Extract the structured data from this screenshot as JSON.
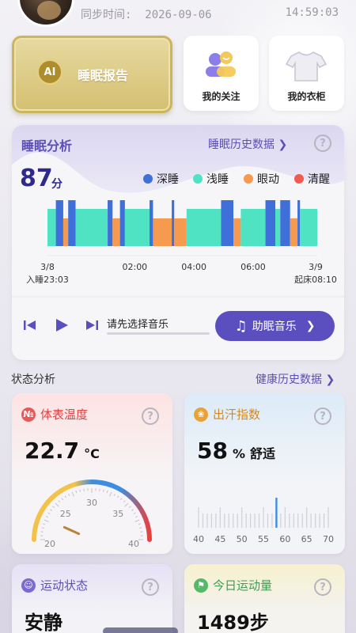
{
  "header": {
    "sync_label": "同步时间:",
    "sync_date": "2026-09-06",
    "sync_time": "14:59:03"
  },
  "top_cards": {
    "ai_badge": "AI",
    "ai_label": "睡眠报告",
    "follow_label": "我的关注",
    "wardrobe_label": "我的衣柜"
  },
  "sleep": {
    "title": "睡眠分析",
    "history_link": "睡眠历史数据",
    "help": "?",
    "score": "87",
    "score_unit": "分",
    "legend": [
      {
        "label": "深睡",
        "color": "#3f6fd8"
      },
      {
        "label": "浅睡",
        "color": "#4fe3c3"
      },
      {
        "label": "眼动",
        "color": "#f59a4f"
      },
      {
        "label": "清醒",
        "color": "#f05a4f"
      }
    ],
    "start_date": "3/8",
    "start_label": "入睡23:03",
    "end_date": "3/9",
    "end_label": "起床08:10",
    "time_ticks": [
      "02:00",
      "04:00",
      "06:00"
    ],
    "music_hint": "请先选择音乐",
    "music_button": "助眠音乐"
  },
  "chart_data": {
    "type": "bar",
    "title": "",
    "xlabel": "",
    "ylabel": "",
    "start": "23:03",
    "end": "08:10",
    "stages": [
      "深睡",
      "浅睡",
      "眼动"
    ],
    "segments": [
      {
        "stage": "浅睡",
        "start": "23:03",
        "end": "23:20"
      },
      {
        "stage": "深睡",
        "start": "23:20",
        "end": "23:35"
      },
      {
        "stage": "眼动",
        "start": "23:35",
        "end": "23:45"
      },
      {
        "stage": "深睡",
        "start": "23:45",
        "end": "24:00"
      },
      {
        "stage": "浅睡",
        "start": "24:00",
        "end": "01:05"
      },
      {
        "stage": "深睡",
        "start": "01:05",
        "end": "01:15"
      },
      {
        "stage": "眼动",
        "start": "01:15",
        "end": "01:30"
      },
      {
        "stage": "深睡",
        "start": "01:30",
        "end": "01:40"
      },
      {
        "stage": "浅睡",
        "start": "01:40",
        "end": "02:30"
      },
      {
        "stage": "深睡",
        "start": "02:30",
        "end": "02:37"
      },
      {
        "stage": "眼动",
        "start": "02:37",
        "end": "03:15"
      },
      {
        "stage": "深睡",
        "start": "03:15",
        "end": "03:20"
      },
      {
        "stage": "眼动",
        "start": "03:20",
        "end": "03:45"
      },
      {
        "stage": "浅睡",
        "start": "03:45",
        "end": "04:55"
      },
      {
        "stage": "深睡",
        "start": "04:55",
        "end": "05:20"
      },
      {
        "stage": "眼动",
        "start": "05:20",
        "end": "05:35"
      },
      {
        "stage": "浅睡",
        "start": "05:35",
        "end": "06:25"
      },
      {
        "stage": "深睡",
        "start": "06:25",
        "end": "06:45"
      },
      {
        "stage": "浅睡",
        "start": "06:45",
        "end": "06:55"
      },
      {
        "stage": "深睡",
        "start": "06:55",
        "end": "07:15"
      },
      {
        "stage": "眼动",
        "start": "07:15",
        "end": "07:30"
      },
      {
        "stage": "深睡",
        "start": "07:30",
        "end": "07:35"
      },
      {
        "stage": "浅睡",
        "start": "07:35",
        "end": "08:10"
      }
    ]
  },
  "status": {
    "title": "状态分析",
    "history_link": "健康历史数据",
    "temp": {
      "title": "体表温度",
      "value": "22.7",
      "unit": "°C",
      "ticks": [
        "20",
        "25",
        "30",
        "35",
        "40"
      ],
      "gauge_value": 22.7,
      "gauge_min": 20,
      "gauge_max": 40
    },
    "sweat": {
      "title": "出汗指数",
      "value": "58",
      "unit": "%",
      "comfort": "舒适",
      "ticks": [
        "40",
        "45",
        "50",
        "55",
        "60",
        "65",
        "70"
      ],
      "marker": 58,
      "min": 40,
      "max": 70
    },
    "motion": {
      "title": "运动状态",
      "value": "安静"
    },
    "today": {
      "title": "今日运动量",
      "value": "1489步"
    }
  }
}
